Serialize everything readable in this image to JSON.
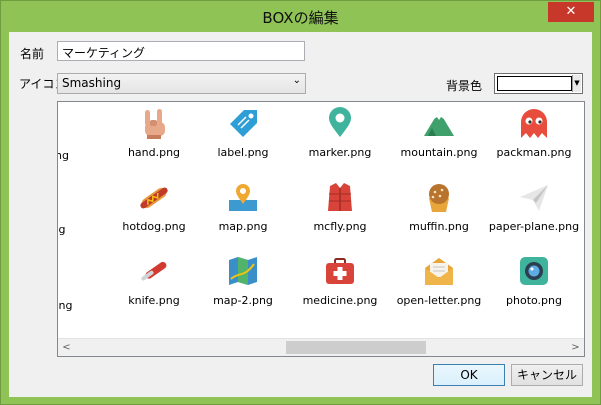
{
  "window": {
    "title": "BOXの編集",
    "close": "✕"
  },
  "form": {
    "name_label": "名前",
    "name_value": "マーケティング",
    "icon_label": "アイコン",
    "icon_set": "Smashing",
    "bg_color_label": "背景色",
    "bg_color_value": "#ffffff"
  },
  "icons": {
    "row1": [
      "hand.png",
      "label.png",
      "marker.png",
      "mountain.png",
      "packman.png"
    ],
    "row2": [
      "hotdog.png",
      "map.png",
      "mcfly.png",
      "muffin.png",
      "paper-plane.png"
    ],
    "row3": [
      "knife.png",
      "map-2.png",
      "medicine.png",
      "open-letter.png",
      "photo.png"
    ],
    "partial": [
      "ng",
      "g",
      "png"
    ]
  },
  "scrollbar": {
    "left": "<",
    "right": ">"
  },
  "buttons": {
    "ok": "OK",
    "cancel": "キャンセル"
  },
  "colors": {
    "frame": "#8fc356",
    "close": "#c7372a"
  }
}
